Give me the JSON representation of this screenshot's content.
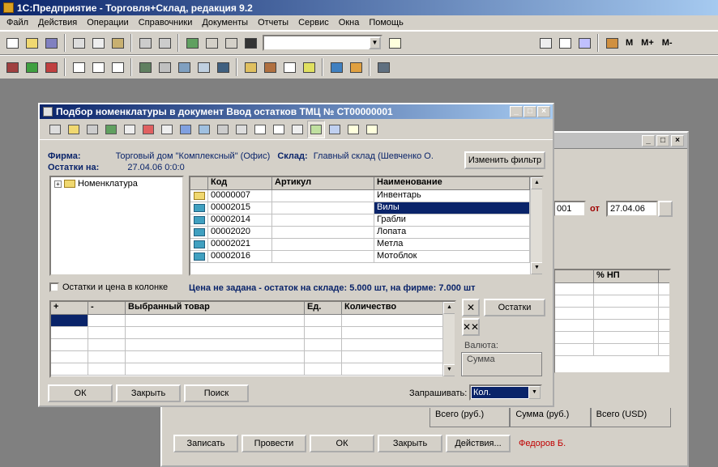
{
  "app": {
    "title": "1С:Предприятие - Торговля+Склад, редакция 9.2"
  },
  "menu": [
    "Файл",
    "Действия",
    "Операции",
    "Справочники",
    "Документы",
    "Отчеты",
    "Сервис",
    "Окна",
    "Помощь"
  ],
  "toolbar": {
    "right_labels": [
      "M",
      "M+",
      "M-"
    ]
  },
  "bg_window": {
    "doc_number_suffix": "001",
    "from_label": "от",
    "date": "27.04.06",
    "column_label": "% НП",
    "totals": [
      "Всего (руб.)",
      "Сумма (руб.)",
      "Всего (USD)"
    ],
    "buttons": [
      "Записать",
      "Провести",
      "ОК",
      "Закрыть",
      "Действия..."
    ],
    "user": "Федоров Б."
  },
  "dialog": {
    "title": "Подбор номенклатуры в документ Ввод остатков ТМЦ № СТ00000001",
    "firm_label": "Фирма:",
    "firm_value": "Торговый дом \"Комплексный\" (Офис)",
    "warehouse_label": "Склад:",
    "warehouse_value": "Главный склад (Шевченко О.",
    "balance_label": "Остатки на:",
    "balance_value": "27.04.06 0:0:0",
    "filter_button": "Изменить фильтр",
    "tree_root": "Номенклатура",
    "columns": {
      "code": "Код",
      "article": "Артикул",
      "name": "Наименование"
    },
    "rows": [
      {
        "code": "00000007",
        "article": "",
        "name": "Инвентарь",
        "root": true
      },
      {
        "code": "00002015",
        "article": "",
        "name": "Вилы",
        "selected": true
      },
      {
        "code": "00002014",
        "article": "",
        "name": "Грабли"
      },
      {
        "code": "00002020",
        "article": "",
        "name": "Лопата"
      },
      {
        "code": "00002021",
        "article": "",
        "name": "Метла"
      },
      {
        "code": "00002016",
        "article": "",
        "name": "Мотоблок"
      }
    ],
    "checkbox_label": "Остатки и цена в колонке",
    "status_line": "Цена не задана -  остаток на складе: 5.000 шт, на фирме: 7.000 шт",
    "selected_columns": {
      "plus": "+",
      "minus": "-",
      "product": "Выбранный товар",
      "unit": "Ед.",
      "qty": "Количество"
    },
    "ostatki_button": "Остатки",
    "valuta_label": "Валюта:",
    "summa_label": "Сумма",
    "buttons": {
      "ok": "ОК",
      "close": "Закрыть",
      "search": "Поиск"
    },
    "ask_label": "Запрашивать:",
    "ask_value": "Кол."
  }
}
